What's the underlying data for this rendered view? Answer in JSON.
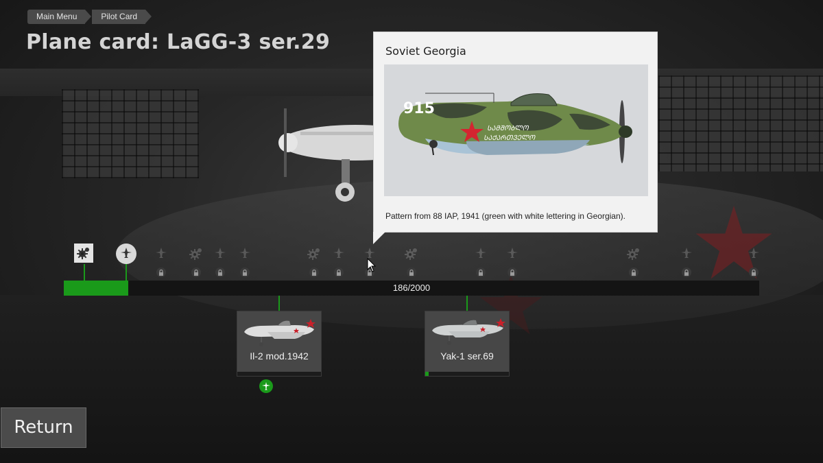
{
  "breadcrumb": {
    "items": [
      "Main Menu",
      "Pilot Card"
    ]
  },
  "page": {
    "title": "Plane card: LaGG-3 ser.29"
  },
  "tooltip": {
    "title": "Soviet Georgia",
    "description": "Pattern from 88 IAP, 1941 (green with white lettering in Georgian).",
    "skin_number": "915"
  },
  "progress": {
    "label": "186/2000",
    "current": 186,
    "max": 2000
  },
  "milestones": [
    {
      "type": "gear",
      "unlocked": true,
      "value": 60
    },
    {
      "type": "skin",
      "unlocked": true,
      "value": 180
    },
    {
      "type": "skin",
      "unlocked": false,
      "value": 280
    },
    {
      "type": "gear",
      "unlocked": false,
      "value": 380
    },
    {
      "type": "skin",
      "unlocked": false,
      "value": 450
    },
    {
      "type": "skin",
      "unlocked": false,
      "value": 520
    },
    {
      "type": "gear",
      "unlocked": false,
      "value": 720
    },
    {
      "type": "skin",
      "unlocked": false,
      "value": 790
    },
    {
      "type": "skin",
      "unlocked": false,
      "value": 880
    },
    {
      "type": "gear",
      "unlocked": false,
      "value": 1000
    },
    {
      "type": "skin",
      "unlocked": false,
      "value": 1200
    },
    {
      "type": "skin",
      "unlocked": false,
      "value": 1290
    },
    {
      "type": "gear",
      "unlocked": false,
      "value": 1640
    },
    {
      "type": "skin",
      "unlocked": false,
      "value": 1790
    },
    {
      "type": "skin",
      "unlocked": false,
      "value": 1985
    }
  ],
  "next_planes": [
    {
      "name": "Il-2 mod.1942",
      "progress": 0,
      "unlocked": true
    },
    {
      "name": "Yak-1 ser.69",
      "progress": 0.04,
      "unlocked": false
    }
  ],
  "buttons": {
    "return_label": "Return"
  },
  "colors": {
    "accent_green": "#1a9a1a",
    "soviet_red": "#c8202a"
  }
}
